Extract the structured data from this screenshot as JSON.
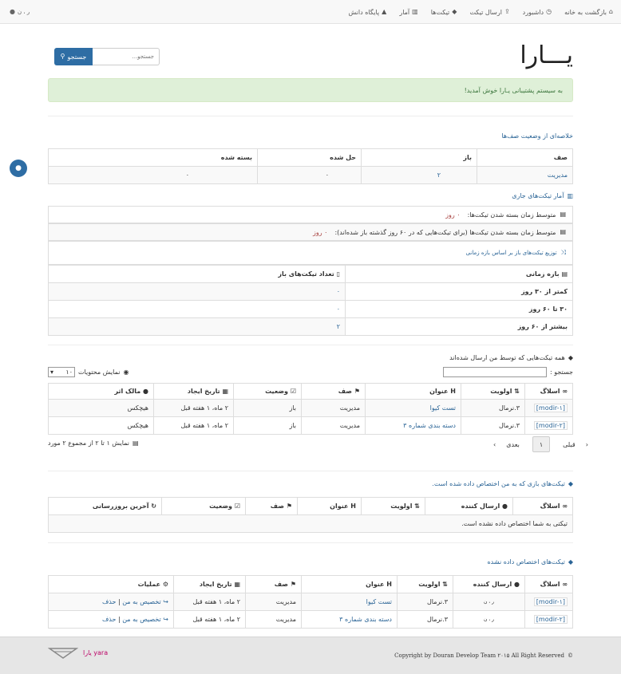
{
  "nav": {
    "back": "بازگشت به خانه",
    "dashboard": "داشبورد",
    "send_ticket": "ارسال تیکت",
    "tickets": "تیکت‌ها",
    "stats": "آمار",
    "knowledge": "پایگاه دانش",
    "user": "ر ، ن"
  },
  "brand": "یـــارا",
  "search": {
    "placeholder": "جستجو...",
    "button": "جستجو"
  },
  "welcome": "به سیستم پشتیبانی یـارا خوش آمدید!",
  "queue_summary": {
    "title": "خلاصه‌ای از وضعیت صف‌ها",
    "headers": [
      "صف",
      "باز",
      "حل شده",
      "بسته شده"
    ],
    "rows": [
      [
        "مدیریت",
        "۲",
        "۰",
        "۰"
      ]
    ]
  },
  "current_stats": {
    "title": "آمار تیکت‌های جاری",
    "avg_close_label": "متوسط زمان بسته شدن تیکت‌ها:",
    "avg_close_value": "۰ روز",
    "avg_close_60_label": "متوسط زمان بسته شدن تیکت‌ها (برای تیکت‌هایی که در ۶۰ روز گذشته باز شده‌اند):",
    "avg_close_60_value": "۰ روز",
    "dist_title": "توزیع تیکت‌های باز بر اساس بازه زمانی",
    "dist_headers": [
      "بازه زمانی",
      "تعداد تیکت‌های باز"
    ],
    "dist_rows": [
      [
        "کمتر از ۳۰ روز",
        "۰"
      ],
      [
        "۳۰ تا ۶۰ روز",
        "۰"
      ],
      [
        "بیشتر از ۶۰ روز",
        "۲"
      ]
    ]
  },
  "my_tickets": {
    "title": "همه تیکت‌هایی که توسط من ارسال شده‌اند",
    "search_label": "جستجو :",
    "show_label": "نمایش محتویات",
    "page_size": "۱۰",
    "headers": [
      "اسلاگ",
      "اولویت",
      "عنوان",
      "صف",
      "وضعیت",
      "تاریخ ایجاد",
      "مالک اثر"
    ],
    "rows": [
      [
        "[modir-۱]",
        "۳.نرمال",
        "تست کیوا",
        "مدیریت",
        "باز",
        "۲ ماه، ۱ هفته قبل",
        "هیچکس"
      ],
      [
        "[modir-۲]",
        "۳.نرمال",
        "دسته بندی شماره ۳",
        "مدیریت",
        "باز",
        "۲ ماه، ۱ هفته قبل",
        "هیچکس"
      ]
    ],
    "info": "نمایش ۱ تا ۲ از مجموع ۲ مورد",
    "prev": "قبلی",
    "page": "۱",
    "next": "بعدی"
  },
  "assigned": {
    "title": "تیکت‌های بازی که به من اختصاص داده شده است.",
    "headers": [
      "اسلاگ",
      "ارسال کننده",
      "اولویت",
      "عنوان",
      "صف",
      "وضعیت",
      "آخرین بروزرسانی"
    ],
    "empty": "تیکتی به شما اختصاص داده نشده است."
  },
  "unassigned": {
    "title": "تیکت‌های اختصاص داده نشده",
    "headers": [
      "اسلاگ",
      "ارسال کننده",
      "اولویت",
      "عنوان",
      "صف",
      "تاریخ ایجاد",
      "عملیات"
    ],
    "rows": [
      [
        "[modir-۱]",
        "ر ، ن",
        "۳.نرمال",
        "تست کیوا",
        "مدیریت",
        "۲ ماه، ۱ هفته قبل"
      ],
      [
        "[modir-۲]",
        "ر ، ن",
        "۳.نرمال",
        "دسته بندی شماره ۳",
        "مدیریت",
        "۲ ماه، ۱ هفته قبل"
      ]
    ],
    "assign_me": "تخصیص به من",
    "delete": "حذف"
  },
  "footer": {
    "copyright": "Copyright by Douran Develop Team ۲۰۱۵ All Right Reserved",
    "logo_text": "یارا yara"
  },
  "colors": {
    "primary": "#2e6da4",
    "success_bg": "#dff0d8",
    "footer_bg": "#e6e6e6"
  }
}
